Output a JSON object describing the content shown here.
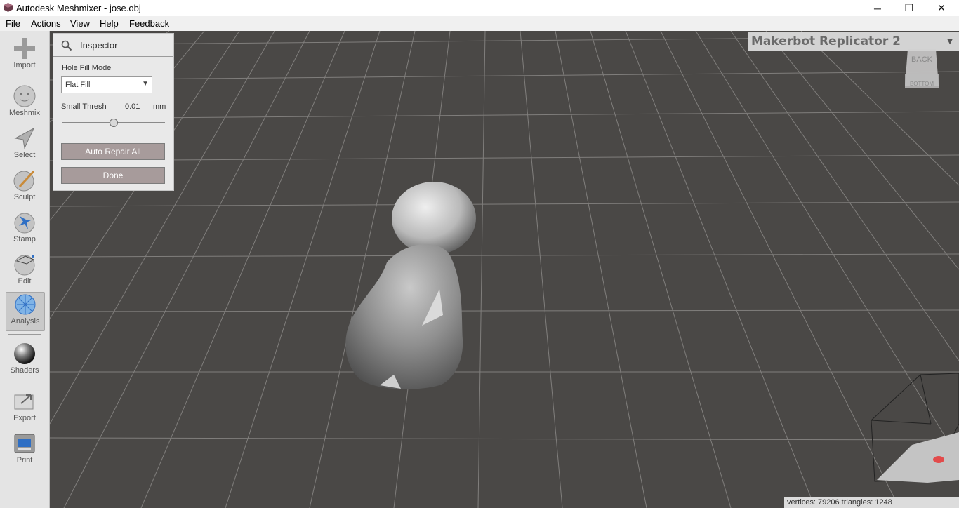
{
  "window": {
    "title": "Autodesk Meshmixer - jose.obj",
    "minimize_glyph": "─",
    "maximize_glyph": "❐",
    "close_glyph": "✕"
  },
  "menu": {
    "items": [
      "File",
      "Actions",
      "View",
      "Help",
      "Feedback"
    ]
  },
  "toolbar": {
    "tools": [
      {
        "label": "Import",
        "icon": "plus-icon"
      },
      {
        "label": "Meshmix",
        "icon": "meshmix-head-icon"
      },
      {
        "label": "Select",
        "icon": "select-arrow-icon"
      },
      {
        "label": "Sculpt",
        "icon": "sculpt-brush-icon"
      },
      {
        "label": "Stamp",
        "icon": "stamp-icon"
      },
      {
        "label": "Edit",
        "icon": "edit-sphere-icon"
      },
      {
        "label": "Analysis",
        "icon": "analysis-icon",
        "active": true
      },
      {
        "label": "Shaders",
        "icon": "shaders-sphere-icon"
      },
      {
        "label": "Export",
        "icon": "export-icon"
      },
      {
        "label": "Print",
        "icon": "print-icon"
      }
    ]
  },
  "inspector": {
    "title": "Inspector",
    "hole_fill_label": "Hole Fill Mode",
    "hole_fill_value": "Flat Fill",
    "small_thresh_label": "Small Thresh",
    "small_thresh_value": "0.01",
    "small_thresh_unit": "mm",
    "small_thresh_slider_fraction": 0.5,
    "auto_repair_label": "Auto Repair All",
    "done_label": "Done"
  },
  "printer": {
    "name": "Makerbot Replicator 2"
  },
  "viewcube": {
    "top_face": "BACK",
    "bottom_face": "BOTTOM"
  },
  "status": {
    "text": "vertices: 79206 triangles: 1248"
  },
  "colors": {
    "viewport_bg": "#4a4846",
    "grid": "#8a8886",
    "button_bg": "#a79b9b"
  }
}
